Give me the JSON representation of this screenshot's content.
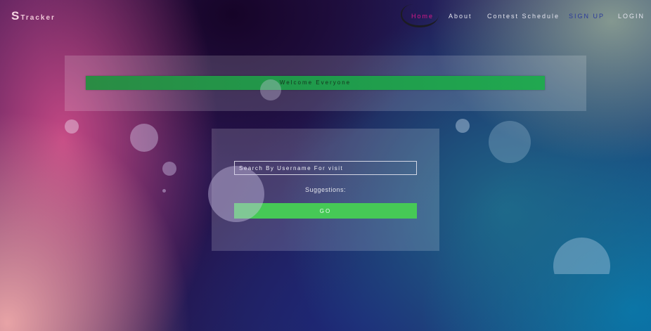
{
  "header": {
    "logo": {
      "initial": "S",
      "rest": "Tracker"
    },
    "nav": [
      {
        "label": "Home",
        "active": true
      },
      {
        "label": "About"
      },
      {
        "label": "Contest Schedule"
      },
      {
        "label": "SIGN UP"
      },
      {
        "label": "LOGIN"
      }
    ]
  },
  "welcome": {
    "text": "Welcome Everyone"
  },
  "search": {
    "placeholder": "Search By Username For visit",
    "suggestions_label": "Suggestions:",
    "go_label": "GO"
  },
  "colors": {
    "active_nav": "#d8198a",
    "welcome_bar": "#1f9a4b",
    "go_button": "#46c956"
  }
}
